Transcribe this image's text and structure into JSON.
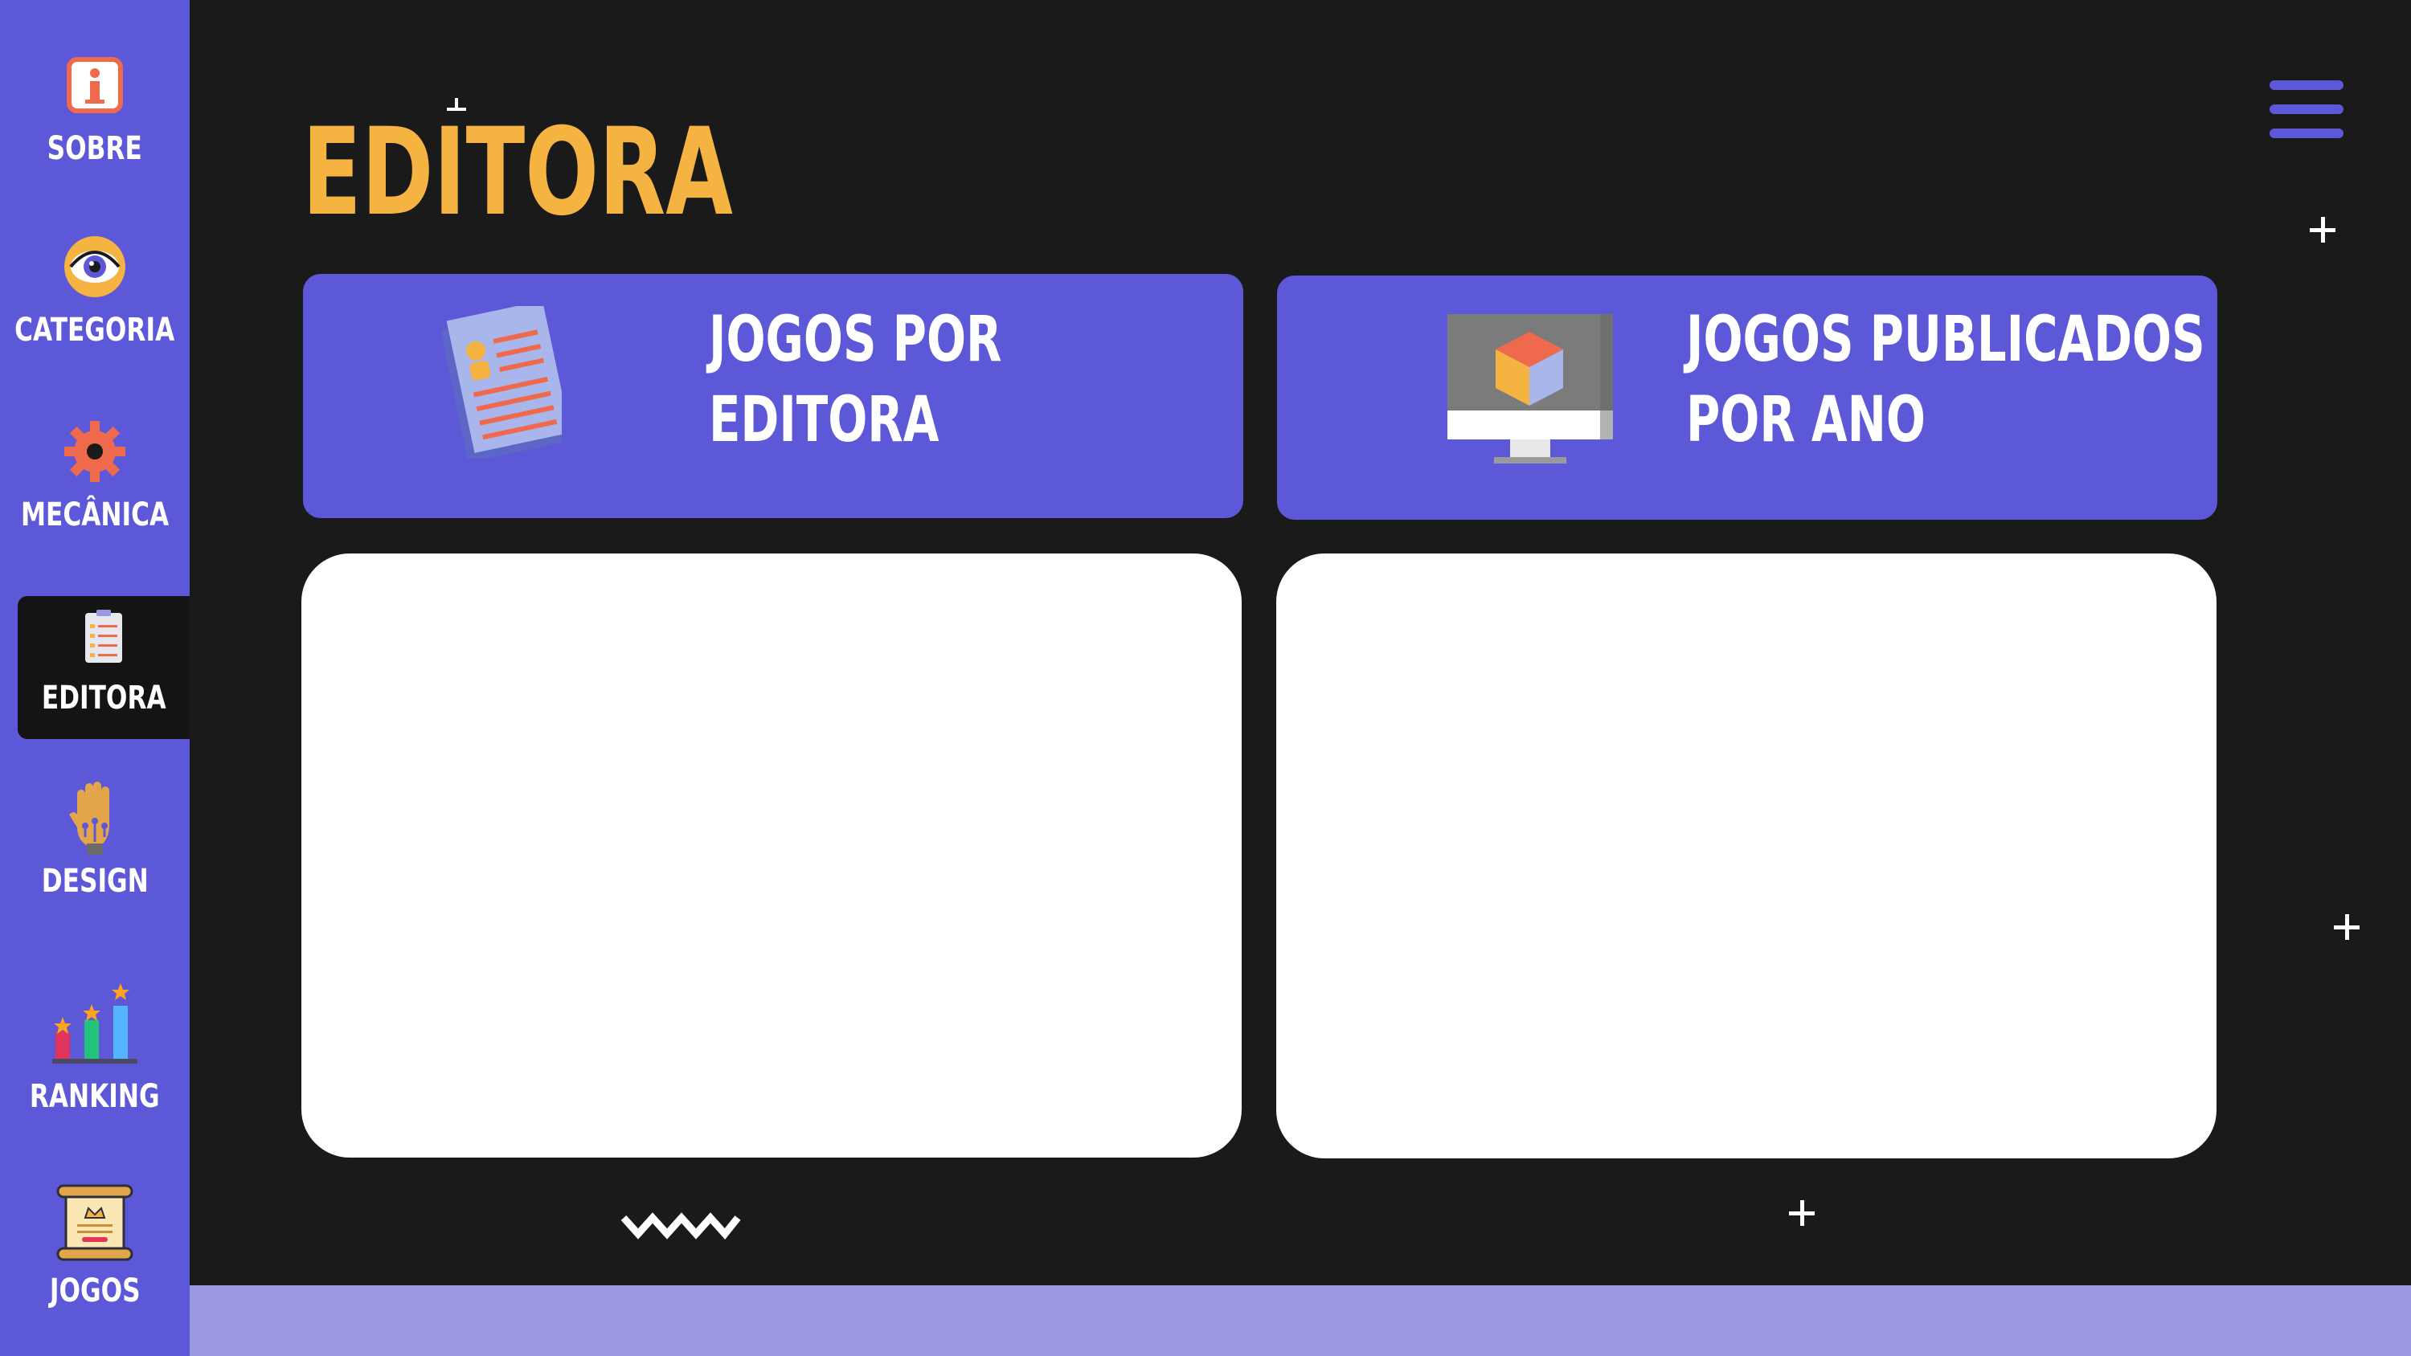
{
  "sidebar": {
    "items": [
      {
        "label": "SOBRE",
        "icon": "info-icon"
      },
      {
        "label": "CATEGORIA",
        "icon": "eye-icon"
      },
      {
        "label": "MECÂNICA",
        "icon": "gear-icon"
      },
      {
        "label": "EDITORA",
        "icon": "clipboard-icon",
        "active": true
      },
      {
        "label": "DESIGN",
        "icon": "hand-circuit-icon"
      },
      {
        "label": "RANKING",
        "icon": "ranking-chart-icon"
      },
      {
        "label": "JOGOS",
        "icon": "scroll-icon"
      }
    ]
  },
  "page": {
    "title": "EDITORA"
  },
  "cards": [
    {
      "line1": "JOGOS POR",
      "line2": "EDITORA",
      "icon": "document-icon"
    },
    {
      "line1": "JOGOS PUBLICADOS",
      "line2": "POR ANO",
      "icon": "monitor-cube-icon"
    }
  ],
  "colors": {
    "background": "#1a1a1a",
    "sidebar": "#5d58d8",
    "accent": "#f5b342",
    "footer": "#9b99e4"
  }
}
